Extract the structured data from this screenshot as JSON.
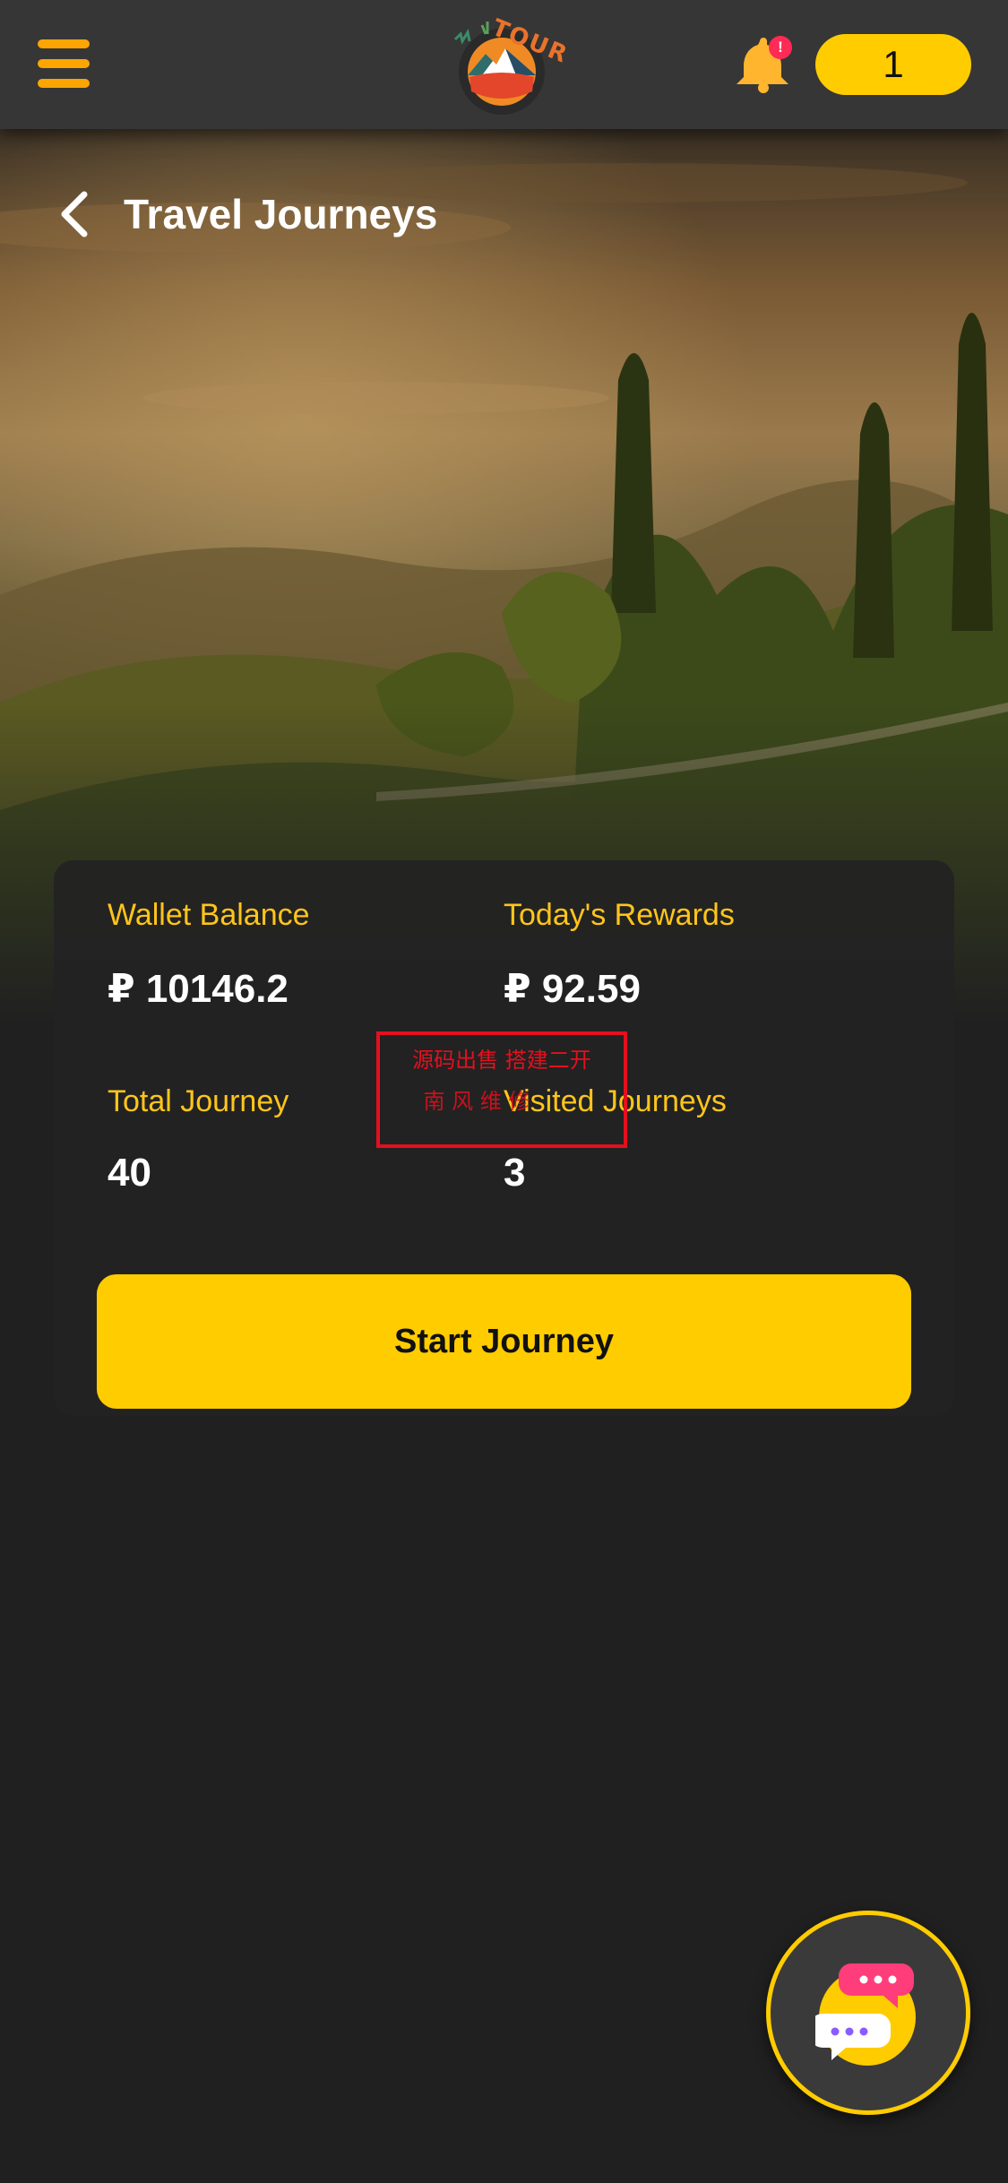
{
  "header": {
    "logo_text": "TOUR",
    "notification_badge": "!",
    "count_value": "1",
    "icons": {
      "menu": "hamburger-menu-icon",
      "bell": "bell-icon",
      "logo": "mountain-sun-logo"
    }
  },
  "page": {
    "title": "Travel Journeys",
    "back_icon": "chevron-left-icon"
  },
  "stats": {
    "wallet_balance": {
      "label": "Wallet Balance",
      "value": "₽ 10146.2"
    },
    "todays_rewards": {
      "label": "Today's Rewards",
      "value": "₽ 92.59"
    },
    "total_journey": {
      "label": "Total Journey",
      "value": "40"
    },
    "visited_journeys": {
      "label": "Visited Journeys",
      "value": "3"
    }
  },
  "actions": {
    "start_label": "Start Journey"
  },
  "watermark": {
    "line1": "源码出售 搭建二开",
    "line2": "南 风 维 修"
  },
  "chat": {
    "icon": "chat-bubbles-icon"
  },
  "colors": {
    "accent": "#ffcc00",
    "menu_orange": "#ffa502",
    "label_yellow": "#ffc51a",
    "badge_red": "#ff2a55",
    "background": "#202020",
    "topbar": "#363636"
  }
}
